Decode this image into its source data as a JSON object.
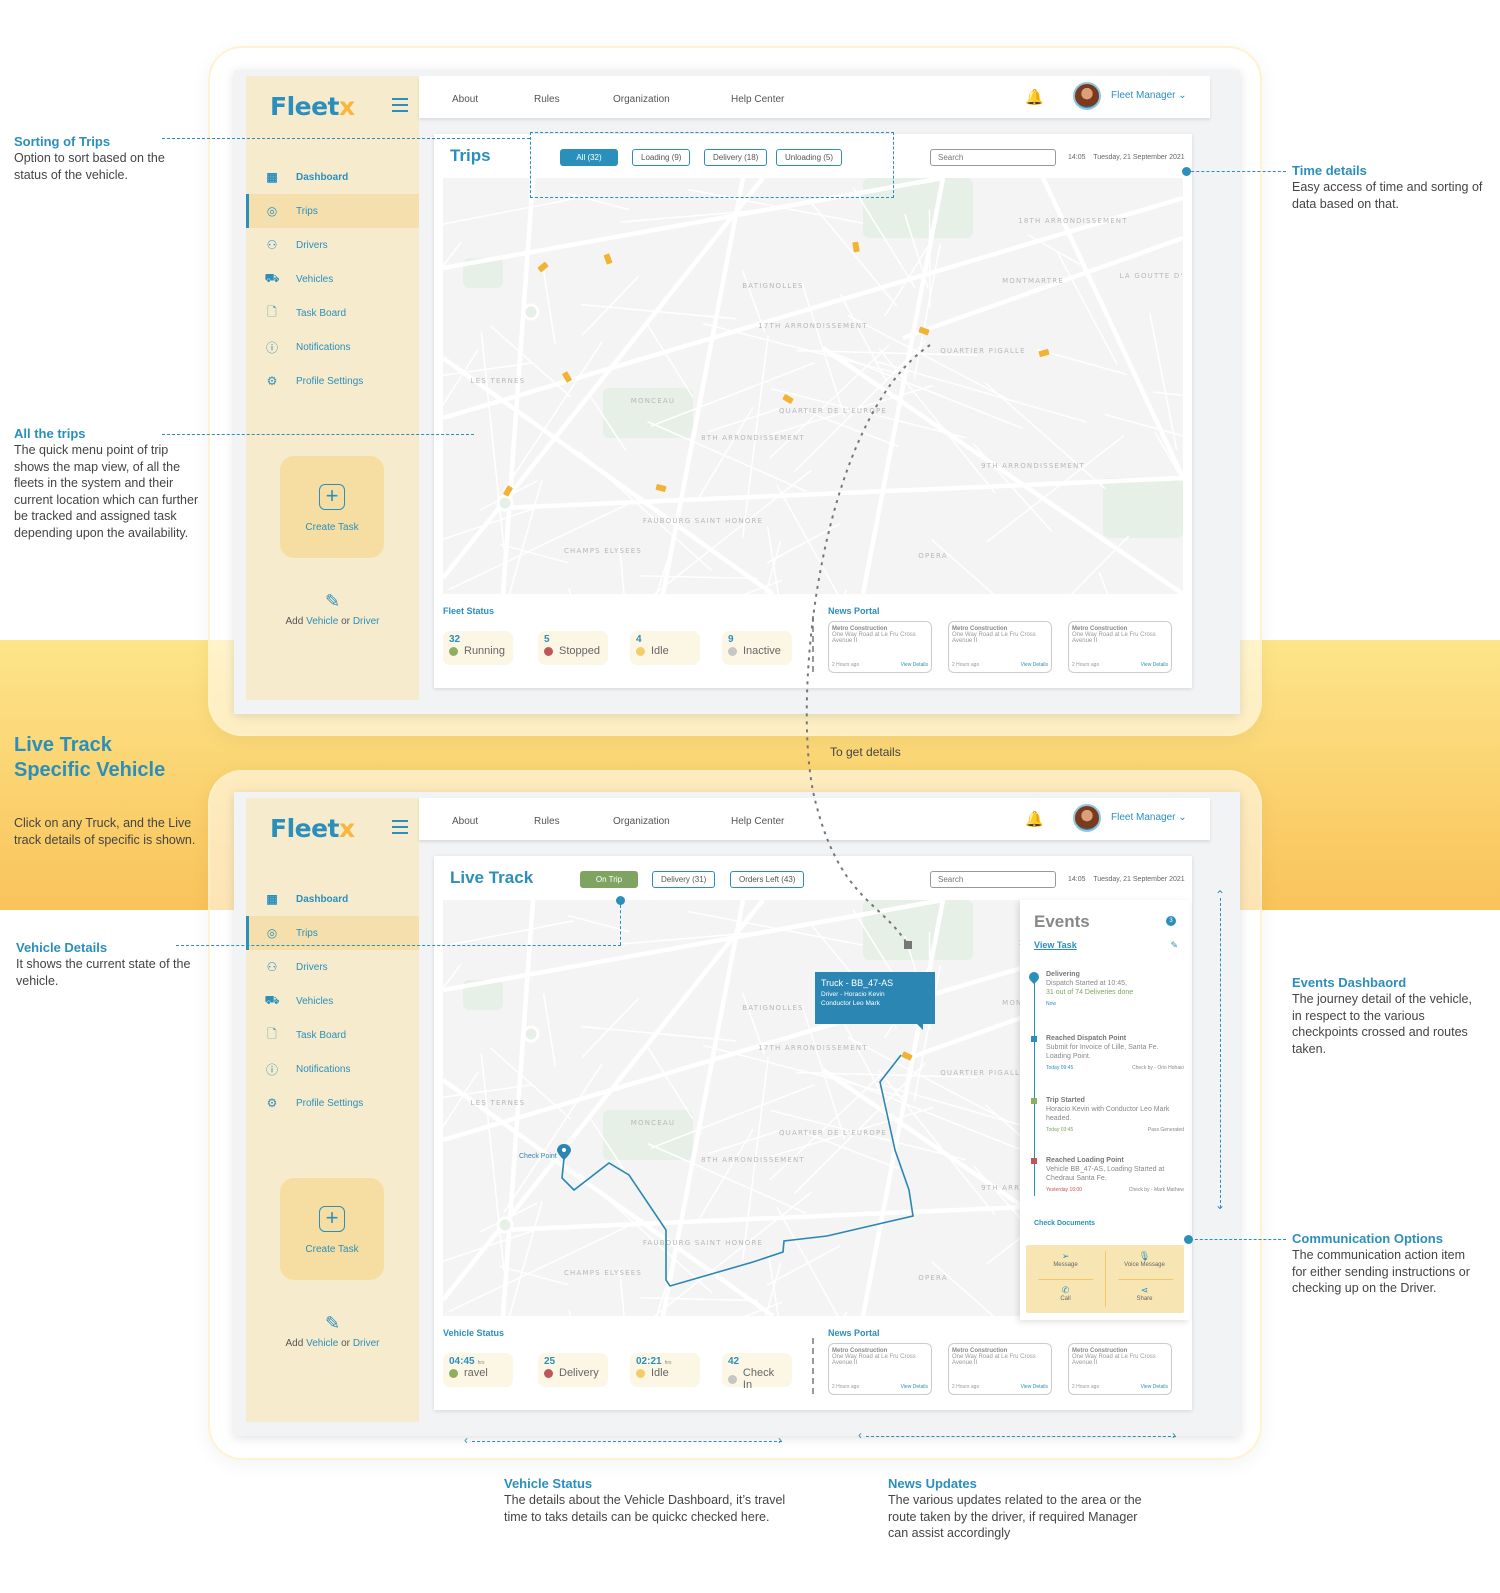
{
  "brand": {
    "name": "Fleet",
    "mark": "x",
    "color": "#2b8fbc",
    "accent": "#f6b73c"
  },
  "topnav": {
    "links": [
      "About",
      "Rules",
      "Organization",
      "Help Center"
    ],
    "user": "Fleet Manager",
    "user_chevron": "chevron-down-icon",
    "bell_icon": "bell-icon"
  },
  "sidebar": {
    "items": [
      {
        "label": "Dashboard",
        "icon": "grid-icon",
        "glyph": "▦"
      },
      {
        "label": "Trips",
        "icon": "location-pin-icon",
        "glyph": "◎",
        "active": true
      },
      {
        "label": "Drivers",
        "icon": "users-icon",
        "glyph": "⚇"
      },
      {
        "label": "Vehicles",
        "icon": "truck-icon",
        "glyph": "⛟"
      },
      {
        "label": "Task Board",
        "icon": "document-icon",
        "glyph": "🗋"
      },
      {
        "label": "Notifications",
        "icon": "info-icon",
        "glyph": "ⓘ"
      },
      {
        "label": "Profile Settings",
        "icon": "gear-icon",
        "glyph": "⚙"
      }
    ],
    "create_task": "Create Task",
    "add_prefix": "Add",
    "add_vehicle": "Vehicle",
    "add_or": "or",
    "add_driver": "Driver"
  },
  "trips_screen": {
    "title": "Trips",
    "filters": [
      "All (32)",
      "Loading (9)",
      "Delivery (18)",
      "Unloading (5)"
    ],
    "active_filter": "All (32)",
    "search_placeholder": "Search",
    "time": "14:05",
    "date": "Tuesday, 21 September 2021",
    "status_title": "Fleet Status",
    "statuses": [
      {
        "value": "32",
        "label": "Running",
        "color": "#8fae62"
      },
      {
        "value": "5",
        "label": "Stopped",
        "color": "#c0565a"
      },
      {
        "value": "4",
        "label": "Idle",
        "color": "#f2cd6a"
      },
      {
        "value": "9",
        "label": "Inactive",
        "color": "#c6c6c6"
      }
    ],
    "map_labels": [
      "BATIGNOLLES",
      "17TH ARRONDISSEMENT",
      "MONTMARTRE",
      "QUARTIER PIGALLE",
      "LES TERNES",
      "MONCEAU",
      "QUARTIER DE L'EUROPE",
      "8TH ARRONDISSEMENT",
      "9TH ARRONDISSEMENT",
      "FAUBOURG SAINT HONORE",
      "CHAMPS ELYSEES",
      "OPERA",
      "18TH ARRONDISSEMENT",
      "LA GOUTTE D'OR"
    ]
  },
  "news": {
    "title": "News Portal",
    "items": [
      {
        "title": "Metro Construction",
        "body": "One Way Road at Le Fru Cross Avenue II",
        "age": "2 Hours ago",
        "link": "View Details"
      },
      {
        "title": "Metro Construction",
        "body": "One Way Road at Le Fru Cross Avenue II",
        "age": "2 Hours ago",
        "link": "View Details"
      },
      {
        "title": "Metro Construction",
        "body": "One Way Road at Le Fru Cross Avenue II",
        "age": "2 Hours ago",
        "link": "View Details"
      }
    ]
  },
  "live_screen": {
    "title": "Live Track",
    "filters": [
      "On Trip",
      "Delivery (31)",
      "Orders Left (43)"
    ],
    "active_filter": "On Trip",
    "search_placeholder": "Search",
    "time": "14:05",
    "date": "Tuesday, 21 September 2021",
    "tooltip": {
      "title": "Truck - BB_47-AS",
      "driver": "Driver - Horacio Kevin",
      "conductor": "Conductor Leo Mark"
    },
    "checkpoint_label": "Check Point",
    "status_title": "Vehicle Status",
    "statuses": [
      {
        "value": "04:45",
        "unit": "hrs",
        "label": "ravel",
        "color": "#8fae62"
      },
      {
        "value": "25",
        "unit": "",
        "label": "Delivery",
        "color": "#c0565a"
      },
      {
        "value": "02:21",
        "unit": "hrs",
        "label": "Idle",
        "color": "#f2cd6a"
      },
      {
        "value": "42",
        "unit": "",
        "label": "Check In",
        "color": "#c6c6c6"
      }
    ],
    "events": {
      "title": "Events",
      "badge": "3",
      "view_task": "View Task",
      "items": [
        {
          "title": "Delivering",
          "line1": "Dispatch Started at 10:45,",
          "line2": "31 out of 74 Deliveries done",
          "when": "Now",
          "note": "",
          "color": "#2b8fbc"
        },
        {
          "title": "Reached Dispatch Point",
          "line1": "Submit for Invoice of Lille, Santa Fe. Loading Point.",
          "line2": "",
          "when": "Today 09:45",
          "note": "Check by - Orio Hohaio",
          "color": "#2b8fbc"
        },
        {
          "title": "Trip Started",
          "line1": "Horacio Kevin with Conductor Leo Mark headed.",
          "line2": "",
          "when": "Today 03:45",
          "note": "Pass Generated",
          "color": "#8fae62"
        },
        {
          "title": "Reached Loading Point",
          "line1": "Vehicle BB_47-AS, Loading Started at Chedraui Santa Fe.",
          "line2": "",
          "when": "Yesterday 16:00",
          "note": "Check by - Mark Mathew",
          "color": "#c0565a"
        }
      ],
      "check_documents": "Check Documents",
      "comm": [
        {
          "label": "Message",
          "icon": "send-icon",
          "glyph": "➢"
        },
        {
          "label": "Voice Message",
          "icon": "microphone-icon",
          "glyph": "🎙"
        },
        {
          "label": "Call",
          "icon": "phone-icon",
          "glyph": "✆"
        },
        {
          "label": "Share",
          "icon": "share-icon",
          "glyph": "⋖"
        }
      ]
    }
  },
  "annotations": {
    "sorting": {
      "title": "Sorting of Trips",
      "body": "Option to sort based on the status of the vehicle."
    },
    "all_trips": {
      "title": "All the trips",
      "body": "The quick menu point of trip shows the map view, of all the fleets in the system and their current location which can further be tracked and assigned task depending upon the availability."
    },
    "time": {
      "title": "Time details",
      "body": "Easy access of time and sorting of data based on that."
    },
    "live_track_title": "Live Track Specific Vehicle",
    "live_track_body": "Click on any Truck, and the Live track details of specific is shown.",
    "to_details": "To get details",
    "vehicle_details": {
      "title": "Vehicle Details",
      "body": "It shows the current state of the vehicle."
    },
    "events_dashboard": {
      "title": "Events Dashbaord",
      "body": "The journey detail of the vehicle, in respect to the various checkpoints crossed and routes taken."
    },
    "communication": {
      "title": "Communication Options",
      "body": "The communication action item for either sending instructions or checking up on the Driver."
    },
    "vehicle_status": {
      "title": "Vehicle Status",
      "body": "The details about the Vehicle Dashboard, it’s travel time to taks details can be quickc checked here."
    },
    "news_updates": {
      "title": "News Updates",
      "body": "The various updates related to the area or the route taken by the driver, if required Manager can assist accordingly"
    }
  }
}
